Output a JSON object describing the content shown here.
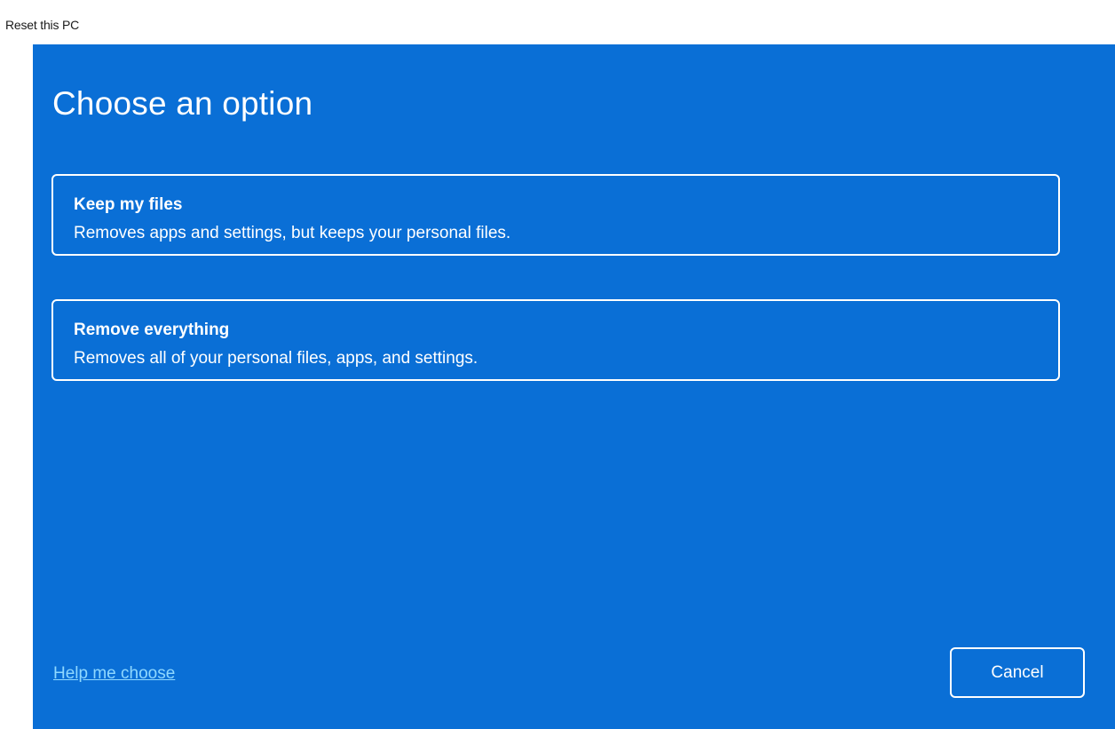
{
  "window": {
    "title": "Reset this PC"
  },
  "main": {
    "heading": "Choose an option",
    "options": [
      {
        "title": "Keep my files",
        "description": "Removes apps and settings, but keeps your personal files."
      },
      {
        "title": "Remove everything",
        "description": "Removes all of your personal files, apps, and settings."
      }
    ]
  },
  "footer": {
    "help_link": "Help me choose",
    "cancel_label": "Cancel"
  },
  "colors": {
    "background": "#0a6fd6",
    "text": "#ffffff",
    "link": "#8fd8ff"
  }
}
